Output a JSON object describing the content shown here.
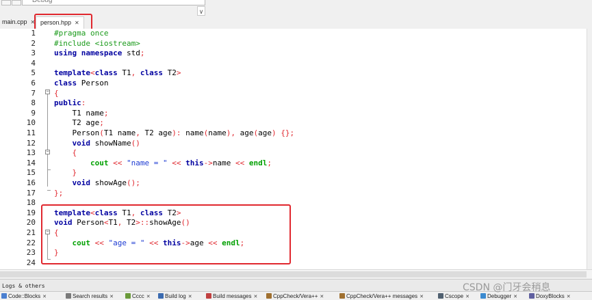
{
  "toolbar": {
    "build_target": "Debug",
    "combo_arrow": "∨"
  },
  "tabs": [
    {
      "label": "main.cpp",
      "close": "✕"
    },
    {
      "label": "person.hpp",
      "close": "✕"
    }
  ],
  "code": {
    "lines": [
      {
        "n": "1",
        "tokens": [
          {
            "t": "pp",
            "v": "#pragma once"
          }
        ]
      },
      {
        "n": "2",
        "tokens": [
          {
            "t": "pp",
            "v": "#include <iostream>"
          }
        ]
      },
      {
        "n": "3",
        "tokens": [
          {
            "t": "kw",
            "v": "using"
          },
          {
            "t": "id",
            "v": " "
          },
          {
            "t": "kw",
            "v": "namespace"
          },
          {
            "t": "id",
            "v": " std"
          },
          {
            "t": "op",
            "v": ";"
          }
        ]
      },
      {
        "n": "4",
        "tokens": []
      },
      {
        "n": "5",
        "tokens": [
          {
            "t": "kw",
            "v": "template"
          },
          {
            "t": "op",
            "v": "<"
          },
          {
            "t": "kw",
            "v": "class"
          },
          {
            "t": "id",
            "v": " T1"
          },
          {
            "t": "op",
            "v": ","
          },
          {
            "t": "id",
            "v": " "
          },
          {
            "t": "kw",
            "v": "class"
          },
          {
            "t": "id",
            "v": " T2"
          },
          {
            "t": "op",
            "v": ">"
          }
        ]
      },
      {
        "n": "6",
        "tokens": [
          {
            "t": "kw",
            "v": "class"
          },
          {
            "t": "id",
            "v": " Person"
          }
        ]
      },
      {
        "n": "7",
        "tokens": [
          {
            "t": "op",
            "v": "{"
          }
        ]
      },
      {
        "n": "8",
        "tokens": [
          {
            "t": "kw",
            "v": "public"
          },
          {
            "t": "op",
            "v": ":"
          }
        ]
      },
      {
        "n": "9",
        "tokens": [
          {
            "t": "id",
            "v": "    T1 name"
          },
          {
            "t": "op",
            "v": ";"
          }
        ]
      },
      {
        "n": "10",
        "tokens": [
          {
            "t": "id",
            "v": "    T2 age"
          },
          {
            "t": "op",
            "v": ";"
          }
        ]
      },
      {
        "n": "11",
        "tokens": [
          {
            "t": "id",
            "v": "    Person"
          },
          {
            "t": "op",
            "v": "("
          },
          {
            "t": "id",
            "v": "T1 name"
          },
          {
            "t": "op",
            "v": ","
          },
          {
            "t": "id",
            "v": " T2 age"
          },
          {
            "t": "op",
            "v": "):"
          },
          {
            "t": "id",
            "v": " name"
          },
          {
            "t": "op",
            "v": "("
          },
          {
            "t": "id",
            "v": "name"
          },
          {
            "t": "op",
            "v": "),"
          },
          {
            "t": "id",
            "v": " age"
          },
          {
            "t": "op",
            "v": "("
          },
          {
            "t": "id",
            "v": "age"
          },
          {
            "t": "op",
            "v": ")"
          },
          {
            "t": "id",
            "v": " "
          },
          {
            "t": "op",
            "v": "{};"
          }
        ]
      },
      {
        "n": "12",
        "tokens": [
          {
            "t": "id",
            "v": "    "
          },
          {
            "t": "kw",
            "v": "void"
          },
          {
            "t": "id",
            "v": " showName"
          },
          {
            "t": "op",
            "v": "()"
          }
        ]
      },
      {
        "n": "13",
        "tokens": [
          {
            "t": "id",
            "v": "    "
          },
          {
            "t": "op",
            "v": "{"
          }
        ]
      },
      {
        "n": "14",
        "tokens": [
          {
            "t": "id",
            "v": "        "
          },
          {
            "t": "kw2",
            "v": "cout"
          },
          {
            "t": "id",
            "v": " "
          },
          {
            "t": "op",
            "v": "<<"
          },
          {
            "t": "id",
            "v": " "
          },
          {
            "t": "str",
            "v": "\"name = \""
          },
          {
            "t": "id",
            "v": " "
          },
          {
            "t": "op",
            "v": "<<"
          },
          {
            "t": "id",
            "v": " "
          },
          {
            "t": "kw",
            "v": "this"
          },
          {
            "t": "op",
            "v": "->"
          },
          {
            "t": "id",
            "v": "name "
          },
          {
            "t": "op",
            "v": "<<"
          },
          {
            "t": "id",
            "v": " "
          },
          {
            "t": "kw2",
            "v": "endl"
          },
          {
            "t": "op",
            "v": ";"
          }
        ]
      },
      {
        "n": "15",
        "tokens": [
          {
            "t": "id",
            "v": "    "
          },
          {
            "t": "op",
            "v": "}"
          }
        ]
      },
      {
        "n": "16",
        "tokens": [
          {
            "t": "id",
            "v": "    "
          },
          {
            "t": "kw",
            "v": "void"
          },
          {
            "t": "id",
            "v": " showAge"
          },
          {
            "t": "op",
            "v": "();"
          }
        ]
      },
      {
        "n": "17",
        "tokens": [
          {
            "t": "op",
            "v": "};"
          }
        ]
      },
      {
        "n": "18",
        "tokens": []
      },
      {
        "n": "19",
        "tokens": [
          {
            "t": "kw",
            "v": "template"
          },
          {
            "t": "op",
            "v": "<"
          },
          {
            "t": "kw",
            "v": "class"
          },
          {
            "t": "id",
            "v": " T1"
          },
          {
            "t": "op",
            "v": ","
          },
          {
            "t": "id",
            "v": " "
          },
          {
            "t": "kw",
            "v": "class"
          },
          {
            "t": "id",
            "v": " T2"
          },
          {
            "t": "op",
            "v": ">"
          }
        ]
      },
      {
        "n": "20",
        "tokens": [
          {
            "t": "kw",
            "v": "void"
          },
          {
            "t": "id",
            "v": " Person"
          },
          {
            "t": "op",
            "v": "<"
          },
          {
            "t": "id",
            "v": "T1"
          },
          {
            "t": "op",
            "v": ","
          },
          {
            "t": "id",
            "v": " T2"
          },
          {
            "t": "op",
            "v": ">::"
          },
          {
            "t": "id",
            "v": "showAge"
          },
          {
            "t": "op",
            "v": "()"
          }
        ]
      },
      {
        "n": "21",
        "tokens": [
          {
            "t": "op",
            "v": "{"
          }
        ]
      },
      {
        "n": "22",
        "tokens": [
          {
            "t": "id",
            "v": "    "
          },
          {
            "t": "kw2",
            "v": "cout"
          },
          {
            "t": "id",
            "v": " "
          },
          {
            "t": "op",
            "v": "<<"
          },
          {
            "t": "id",
            "v": " "
          },
          {
            "t": "str",
            "v": "\"age = \""
          },
          {
            "t": "id",
            "v": " "
          },
          {
            "t": "op",
            "v": "<<"
          },
          {
            "t": "id",
            "v": " "
          },
          {
            "t": "kw",
            "v": "this"
          },
          {
            "t": "op",
            "v": "->"
          },
          {
            "t": "id",
            "v": "age "
          },
          {
            "t": "op",
            "v": "<<"
          },
          {
            "t": "id",
            "v": " "
          },
          {
            "t": "kw2",
            "v": "endl"
          },
          {
            "t": "op",
            "v": ";"
          }
        ]
      },
      {
        "n": "23",
        "tokens": [
          {
            "t": "op",
            "v": "}"
          }
        ]
      },
      {
        "n": "24",
        "tokens": []
      }
    ]
  },
  "logs": {
    "title": "Logs & others",
    "tabs": [
      {
        "label": "Code::Blocks",
        "icon": "codeblocks-icon",
        "color": "#4a7fd0"
      },
      {
        "label": "Search results",
        "icon": "search-icon",
        "color": "#7a7a7a"
      },
      {
        "label": "Cccc",
        "icon": "cccc-icon",
        "color": "#6a9a3a"
      },
      {
        "label": "Build log",
        "icon": "gear-icon",
        "color": "#3a6ab0"
      },
      {
        "label": "Build messages",
        "icon": "build-messages-icon",
        "color": "#c04040"
      },
      {
        "label": "CppCheck/Vera++",
        "icon": "cppcheck-icon",
        "color": "#a07030"
      },
      {
        "label": "CppCheck/Vera++ messages",
        "icon": "cppcheck-messages-icon",
        "color": "#a07030"
      },
      {
        "label": "Cscope",
        "icon": "cscope-icon",
        "color": "#506070"
      },
      {
        "label": "Debugger",
        "icon": "debugger-icon",
        "color": "#3a8ad0"
      },
      {
        "label": "DoxyBlocks",
        "icon": "doxyblocks-icon",
        "color": "#6060a0"
      }
    ]
  },
  "watermark": "CSDN @门牙会稍息",
  "colors": {
    "highlight_box": "#e0262d",
    "keyword": "#0000a0",
    "preprocessor": "#1a9a1a",
    "string": "#1d3bd2",
    "operator": "#e0262d"
  }
}
